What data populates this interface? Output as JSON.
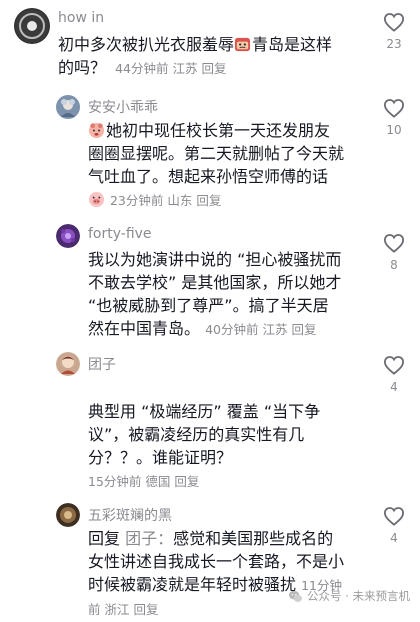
{
  "comments": [
    {
      "username": "how in",
      "text_line1": "初中多次被扒光衣服羞辱",
      "text_line1b": "青岛是这样",
      "text_line2": "的吗？",
      "time": "44分钟前",
      "location": "江苏",
      "reply": "回复",
      "likes": "23"
    },
    {
      "username": "安安小乖乖",
      "text_line1": "她初中现任校长第一天还发朋友",
      "text_line2": "圈圈显摆呢。第二天就删帖了今天就",
      "text_line3": "气吐血了。想起来孙悟空师傅的话",
      "time": "23分钟前",
      "location": "山东",
      "reply": "回复",
      "likes": "10"
    },
    {
      "username": "forty-five",
      "text_line1": "我以为她演讲中说的 “担心被骚扰而",
      "text_line2": "不敢去学校” 是其他国家，所以她才",
      "text_line3": "“也被威胁到了尊严”。搞了半天居",
      "text_line4": "然在中国青岛。",
      "time": "40分钟前",
      "location": "江苏",
      "reply": "回复",
      "likes": "8"
    },
    {
      "username": "团子",
      "text_line1": "典型用 “极端经历” 覆盖 “当下争",
      "text_line2": "议”，被霸凌经历的真实性有几",
      "text_line3": "分？？。谁能证明？",
      "time": "15分钟前",
      "location": "德国",
      "reply": "回复",
      "likes": "4"
    },
    {
      "username": "五彩斑斓的黑",
      "reply_prefix": "回复",
      "reply_to": "团子：",
      "text_line1": "感觉和美国那些成名的",
      "text_line2": "女性讲述自我成长一个套路，不是小",
      "text_line3": "时候被霸凌就是年轻时被骚扰",
      "time_a": "11分钟",
      "time_b": "前",
      "location": "浙江",
      "reply": "回复",
      "likes": "4"
    }
  ],
  "watermark": {
    "text": "公众号 · 未来预言机"
  },
  "icons": {
    "like": "heart-outline-icon",
    "emoji_angry": "angry-face-emoji-icon",
    "emoji_cry": "crying-face-emoji-icon",
    "emoji_pig": "pig-face-emoji-icon",
    "wechat": "wechat-icon"
  }
}
